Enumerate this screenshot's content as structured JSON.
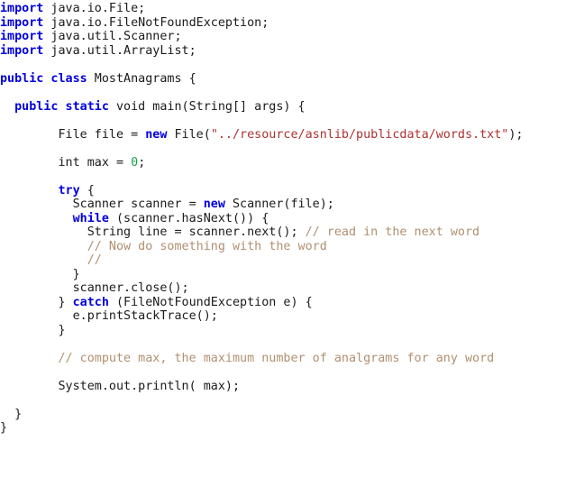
{
  "editor": {
    "language": "java",
    "class_name": "MostAnagrams",
    "background_color": "#ffffff",
    "colors": {
      "keyword": "#0000e0",
      "string": "#b03030",
      "number": "#1a9e4b",
      "comment": "#b09070",
      "plain": "#1a1a1a"
    },
    "lines": [
      {
        "tokens": [
          {
            "t": "import",
            "k": "kw"
          },
          {
            "t": " java.io.File;",
            "k": "plain"
          }
        ]
      },
      {
        "tokens": [
          {
            "t": "import",
            "k": "kw"
          },
          {
            "t": " java.io.FileNotFoundException;",
            "k": "plain"
          }
        ]
      },
      {
        "tokens": [
          {
            "t": "import",
            "k": "kw"
          },
          {
            "t": " java.util.Scanner;",
            "k": "plain"
          }
        ]
      },
      {
        "tokens": [
          {
            "t": "import",
            "k": "kw"
          },
          {
            "t": " java.util.ArrayList;",
            "k": "plain"
          }
        ]
      },
      {
        "tokens": []
      },
      {
        "tokens": [
          {
            "t": "public class",
            "k": "kw"
          },
          {
            "t": " MostAnagrams {",
            "k": "plain"
          }
        ]
      },
      {
        "tokens": []
      },
      {
        "tokens": [
          {
            "t": "  ",
            "k": "plain"
          },
          {
            "t": "public static",
            "k": "kw"
          },
          {
            "t": " void main(String[] args) {",
            "k": "plain"
          }
        ]
      },
      {
        "tokens": []
      },
      {
        "tokens": [
          {
            "t": "        File file = ",
            "k": "plain"
          },
          {
            "t": "new",
            "k": "kw"
          },
          {
            "t": " File(",
            "k": "plain"
          },
          {
            "t": "\"../resource/asnlib/publicdata/words.txt\"",
            "k": "str"
          },
          {
            "t": ");",
            "k": "plain"
          }
        ]
      },
      {
        "tokens": []
      },
      {
        "tokens": [
          {
            "t": "        int max = ",
            "k": "plain"
          },
          {
            "t": "0",
            "k": "num"
          },
          {
            "t": ";",
            "k": "plain"
          }
        ]
      },
      {
        "tokens": []
      },
      {
        "tokens": [
          {
            "t": "        ",
            "k": "plain"
          },
          {
            "t": "try",
            "k": "kw"
          },
          {
            "t": " {",
            "k": "plain"
          }
        ]
      },
      {
        "tokens": [
          {
            "t": "          Scanner scanner = ",
            "k": "plain"
          },
          {
            "t": "new",
            "k": "kw"
          },
          {
            "t": " Scanner(file);",
            "k": "plain"
          }
        ]
      },
      {
        "tokens": [
          {
            "t": "          ",
            "k": "plain"
          },
          {
            "t": "while",
            "k": "kw"
          },
          {
            "t": " (scanner.hasNext()) {",
            "k": "plain"
          }
        ]
      },
      {
        "tokens": [
          {
            "t": "            String line = scanner.next(); ",
            "k": "plain"
          },
          {
            "t": "// read in the next word",
            "k": "com"
          }
        ]
      },
      {
        "tokens": [
          {
            "t": "            ",
            "k": "plain"
          },
          {
            "t": "// Now do something with the word",
            "k": "com"
          }
        ]
      },
      {
        "tokens": [
          {
            "t": "            ",
            "k": "plain"
          },
          {
            "t": "//",
            "k": "com"
          }
        ]
      },
      {
        "tokens": [
          {
            "t": "          }",
            "k": "plain"
          }
        ]
      },
      {
        "tokens": [
          {
            "t": "          scanner.close();",
            "k": "plain"
          }
        ]
      },
      {
        "tokens": [
          {
            "t": "        } ",
            "k": "plain"
          },
          {
            "t": "catch",
            "k": "kw"
          },
          {
            "t": " (FileNotFoundException e) {",
            "k": "plain"
          }
        ]
      },
      {
        "tokens": [
          {
            "t": "          e.printStackTrace();",
            "k": "plain"
          }
        ]
      },
      {
        "tokens": [
          {
            "t": "        }",
            "k": "plain"
          }
        ]
      },
      {
        "tokens": []
      },
      {
        "tokens": [
          {
            "t": "        ",
            "k": "plain"
          },
          {
            "t": "// compute max, the maximum number of analgrams for any word",
            "k": "com"
          }
        ]
      },
      {
        "tokens": []
      },
      {
        "tokens": [
          {
            "t": "        System.out.println( max);",
            "k": "plain"
          }
        ]
      },
      {
        "tokens": []
      },
      {
        "tokens": [
          {
            "t": "  }",
            "k": "plain"
          }
        ]
      },
      {
        "tokens": [
          {
            "t": "}",
            "k": "plain"
          }
        ]
      }
    ]
  }
}
